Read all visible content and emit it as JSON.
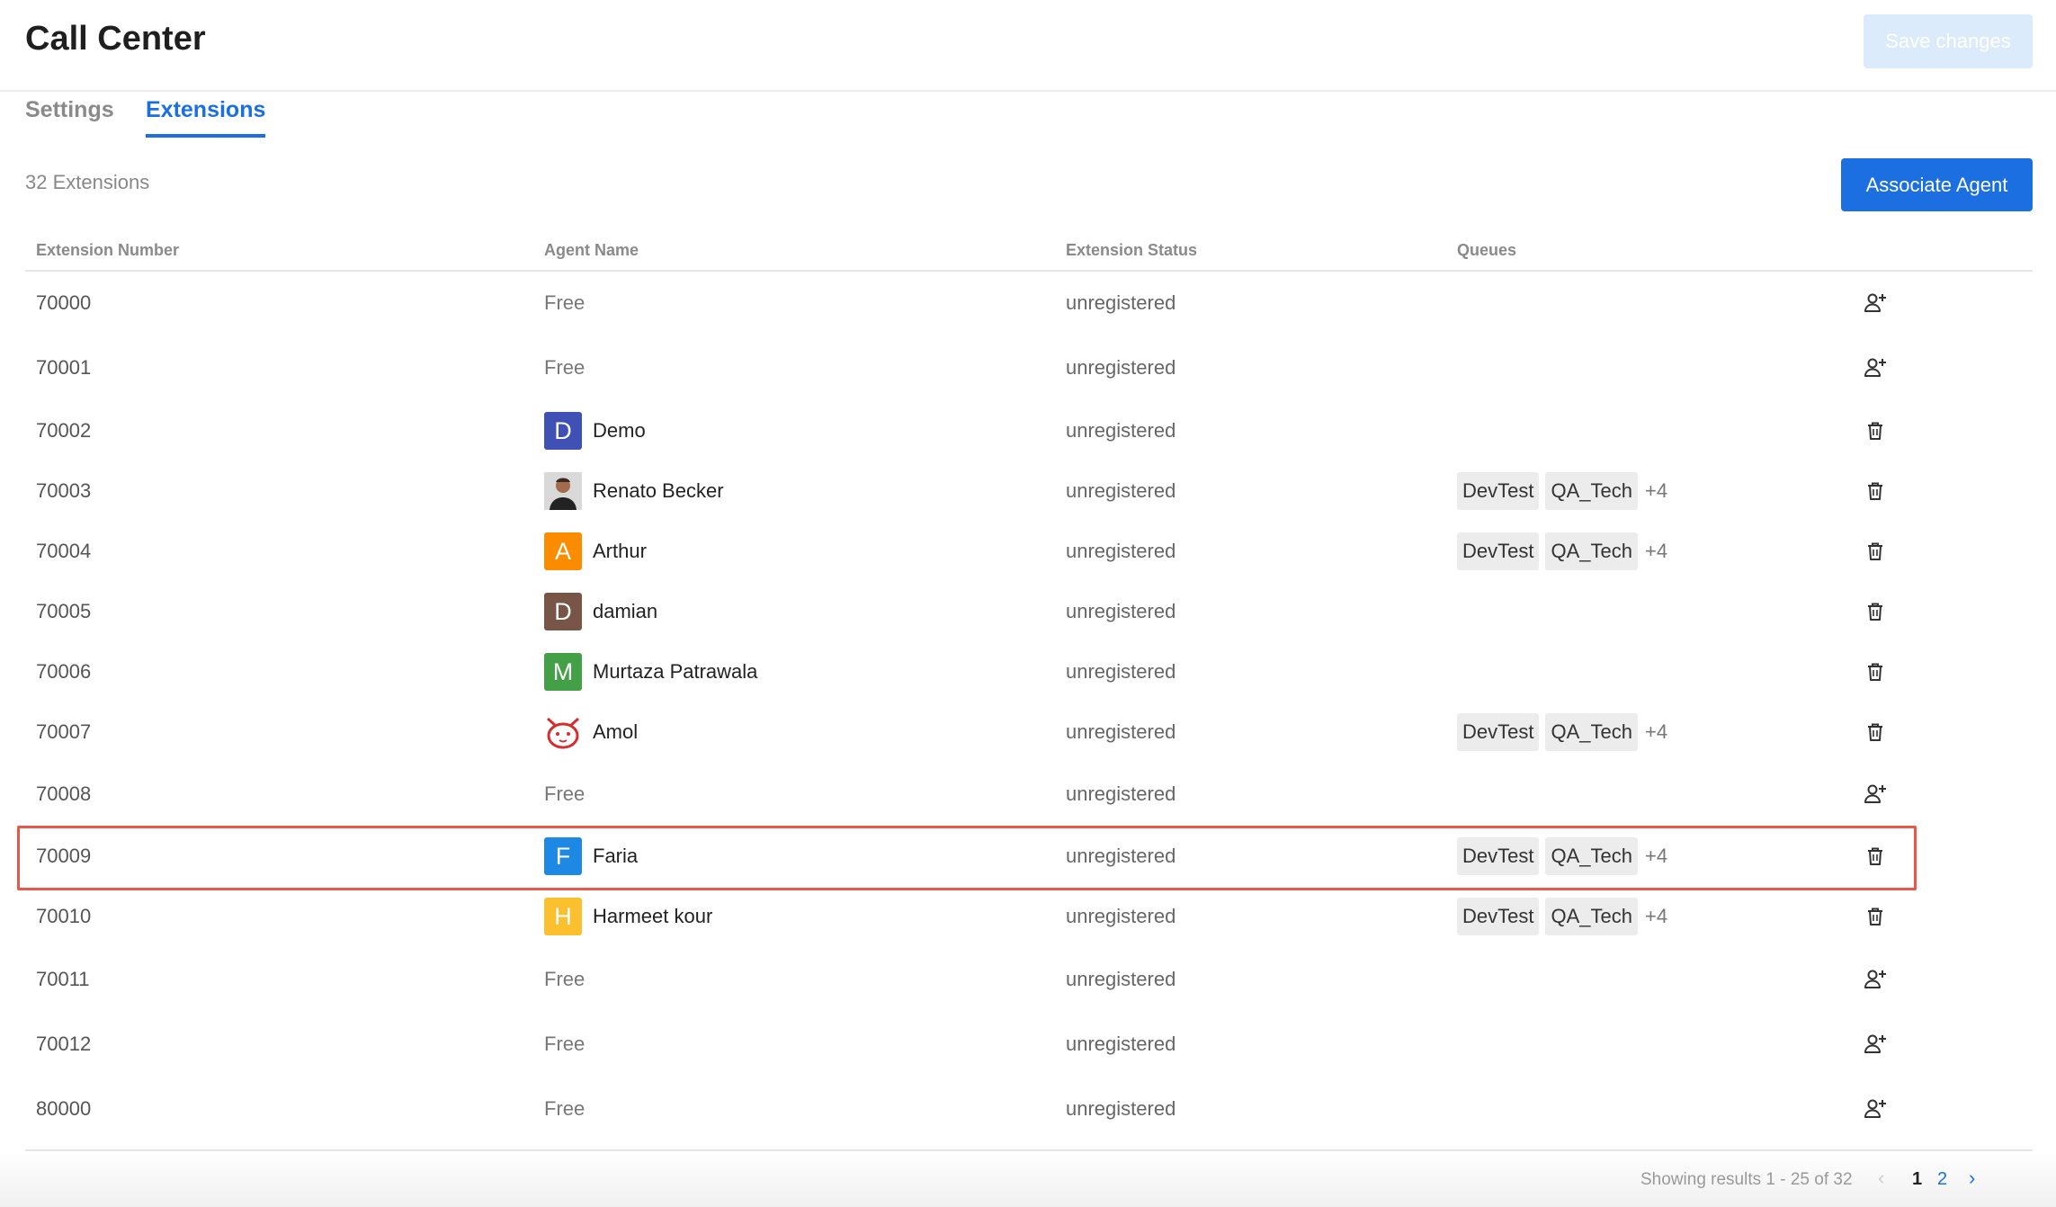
{
  "header": {
    "title": "Call Center",
    "save_label": "Save changes"
  },
  "tabs": [
    {
      "label": "Settings",
      "active": false
    },
    {
      "label": "Extensions",
      "active": true
    }
  ],
  "toolbar": {
    "count_label": "32 Extensions",
    "associate_label": "Associate Agent"
  },
  "table": {
    "columns": [
      "Extension Number",
      "Agent Name",
      "Extension Status",
      "Queues"
    ],
    "rows": [
      {
        "ext": "70000",
        "agent": "Free",
        "status": "unregistered",
        "queues": [],
        "more": "",
        "action": "add-agent-icon"
      },
      {
        "ext": "70001",
        "agent": "Free",
        "status": "unregistered",
        "queues": [],
        "more": "",
        "action": "add-agent-icon"
      },
      {
        "ext": "70002",
        "agent": "Demo",
        "avatar": {
          "letter": "D",
          "color": "#3f51b5"
        },
        "status": "unregistered",
        "queues": [],
        "more": "",
        "action": "delete-icon"
      },
      {
        "ext": "70003",
        "agent": "Renato Becker",
        "avatar": {
          "photo": "person-photo"
        },
        "status": "unregistered",
        "queues": [
          "DevTest",
          "QA_Tech"
        ],
        "more": "+4",
        "action": "delete-icon"
      },
      {
        "ext": "70004",
        "agent": "Arthur",
        "avatar": {
          "letter": "A",
          "color": "#fb8c00"
        },
        "status": "unregistered",
        "queues": [
          "DevTest",
          "QA_Tech"
        ],
        "more": "+4",
        "action": "delete-icon"
      },
      {
        "ext": "70005",
        "agent": "damian",
        "avatar": {
          "letter": "D",
          "color": "#795548"
        },
        "status": "unregistered",
        "queues": [],
        "more": "",
        "action": "delete-icon"
      },
      {
        "ext": "70006",
        "agent": "Murtaza Patrawala",
        "avatar": {
          "letter": "M",
          "color": "#43a047"
        },
        "status": "unregistered",
        "queues": [],
        "more": "",
        "action": "delete-icon"
      },
      {
        "ext": "70007",
        "agent": "Amol",
        "avatar": {
          "photo": "cat-face-icon"
        },
        "status": "unregistered",
        "queues": [
          "DevTest",
          "QA_Tech"
        ],
        "more": "+4",
        "action": "delete-icon"
      },
      {
        "ext": "70008",
        "agent": "Free",
        "status": "unregistered",
        "queues": [],
        "more": "",
        "action": "add-agent-icon"
      },
      {
        "ext": "70009",
        "agent": "Faria",
        "avatar": {
          "letter": "F",
          "color": "#1e88e5"
        },
        "status": "unregistered",
        "queues": [
          "DevTest",
          "QA_Tech"
        ],
        "more": "+4",
        "action": "delete-icon",
        "highlighted": true
      },
      {
        "ext": "70010",
        "agent": "Harmeet kour",
        "avatar": {
          "letter": "H",
          "color": "#fbc02d"
        },
        "status": "unregistered",
        "queues": [
          "DevTest",
          "QA_Tech"
        ],
        "more": "+4",
        "action": "delete-icon"
      },
      {
        "ext": "70011",
        "agent": "Free",
        "status": "unregistered",
        "queues": [],
        "more": "",
        "action": "add-agent-icon"
      },
      {
        "ext": "70012",
        "agent": "Free",
        "status": "unregistered",
        "queues": [],
        "more": "",
        "action": "add-agent-icon"
      },
      {
        "ext": "80000",
        "agent": "Free",
        "status": "unregistered",
        "queues": [],
        "more": "",
        "action": "add-agent-icon"
      }
    ]
  },
  "pagination": {
    "results_label": "Showing results 1 - 25 of 32",
    "prev": "‹",
    "pages": [
      "1",
      "2"
    ],
    "current": "1",
    "next": "›"
  },
  "colors": {
    "accent": "#1b6fe0",
    "highlight_border": "#e8574a",
    "save_disabled": "#dcebfb"
  }
}
